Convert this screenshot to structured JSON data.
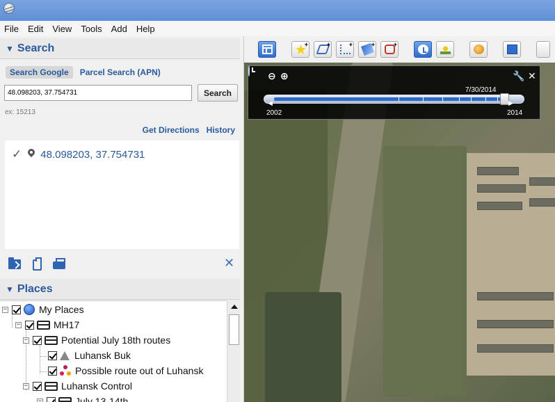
{
  "menu": [
    "File",
    "Edit",
    "View",
    "Tools",
    "Add",
    "Help"
  ],
  "search": {
    "header": "Search",
    "tabs": [
      "Search Google",
      "Parcel Search (APN)"
    ],
    "input_value": "48.098203, 37.754731",
    "button": "Search",
    "example": "ex: 15213",
    "links": [
      "Get Directions",
      "History"
    ],
    "result": "48.098203, 37.754731"
  },
  "places": {
    "header": "Places",
    "items": [
      {
        "label": "My Places",
        "level": 0,
        "icon": "globe-icon"
      },
      {
        "label": "MH17",
        "level": 1,
        "icon": "folder-icon"
      },
      {
        "label": "Potential July 18th routes",
        "level": 2,
        "icon": "folder-icon"
      },
      {
        "label": "Luhansk Buk",
        "level": 3,
        "icon": "warning-icon"
      },
      {
        "label": "Possible route out of Luhansk",
        "level": 3,
        "icon": "route-icon"
      },
      {
        "label": "Luhansk Control",
        "level": 2,
        "icon": "folder-icon"
      },
      {
        "label": "July 13-14th",
        "level": 3,
        "icon": "folder-icon"
      }
    ]
  },
  "time_slider": {
    "current_date": "7/30/2014",
    "start_year": "2002",
    "end_year": "2014",
    "position": 0.96
  },
  "colors": {
    "accent": "#2a5a9c",
    "titlebar": "#6f9de0"
  }
}
